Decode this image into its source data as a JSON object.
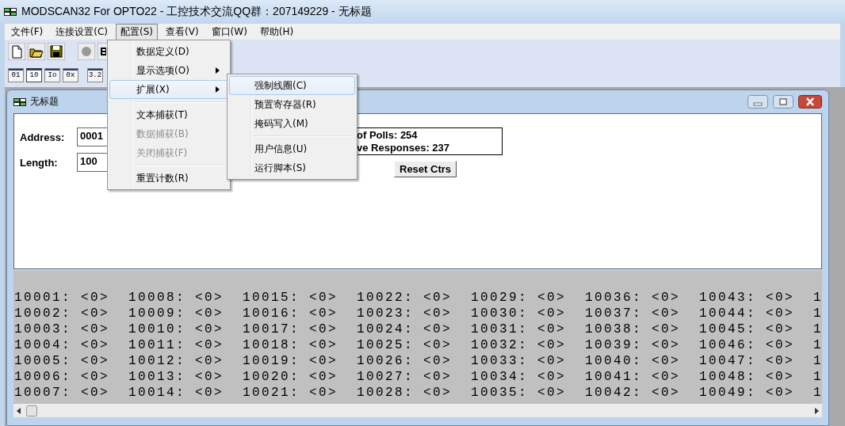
{
  "window": {
    "title": "MODSCAN32 For OPTO22 - 工控技术交流QQ群：207149229 - 无标题"
  },
  "menubar": [
    {
      "label": "文件(F)",
      "selected": false
    },
    {
      "label": "连接设置(C)",
      "selected": false
    },
    {
      "label": "配置(S)",
      "selected": true
    },
    {
      "label": "查看(V)",
      "selected": false
    },
    {
      "label": "窗口(W)",
      "selected": false
    },
    {
      "label": "帮助(H)",
      "selected": false
    }
  ],
  "toolbar_views": [
    {
      "label": "01",
      "selected": false
    },
    {
      "label": "10",
      "selected": true
    },
    {
      "label": "Io",
      "selected": false
    },
    {
      "label": "0x",
      "selected": false
    },
    {
      "label": "3.2",
      "selected": false
    }
  ],
  "menu": [
    {
      "kind": "item",
      "label": "数据定义(D)",
      "selected": false,
      "disabled": false,
      "submenu": false
    },
    {
      "kind": "item",
      "label": "显示选项(O)",
      "selected": false,
      "disabled": false,
      "submenu": true
    },
    {
      "kind": "item",
      "label": "扩展(X)",
      "selected": true,
      "disabled": false,
      "submenu": true
    },
    {
      "kind": "separator"
    },
    {
      "kind": "item",
      "label": "文本捕获(T)",
      "selected": false,
      "disabled": false,
      "submenu": false
    },
    {
      "kind": "item",
      "label": "数据捕获(B)",
      "selected": false,
      "disabled": true,
      "submenu": false
    },
    {
      "kind": "item",
      "label": "关闭捕获(F)",
      "selected": false,
      "disabled": true,
      "submenu": false
    },
    {
      "kind": "separator"
    },
    {
      "kind": "item",
      "label": "重置计数(R)",
      "selected": false,
      "disabled": false,
      "submenu": false
    }
  ],
  "submenu": [
    {
      "kind": "item",
      "label": "强制线圈(C)",
      "selected": true
    },
    {
      "kind": "item",
      "label": "预置寄存器(R)",
      "selected": false
    },
    {
      "kind": "item",
      "label": "掩码写入(M)",
      "selected": false
    },
    {
      "kind": "separator"
    },
    {
      "kind": "item",
      "label": "用户信息(U)",
      "selected": false
    },
    {
      "kind": "item",
      "label": "运行脚本(S)",
      "selected": false
    }
  ],
  "child_window": {
    "title": "无标题",
    "address": {
      "label": "Address:",
      "value": "0001"
    },
    "length": {
      "label": "Length:",
      "value": "100"
    },
    "counters": [
      "of Polls: 254",
      "ve Responses: 237"
    ],
    "reset_button": "Reset Ctrs",
    "data_rows": [
      [
        "10001: <0>",
        "10008: <0>",
        "10015: <0>",
        "10022: <0>",
        "10029: <0>",
        "10036: <0>",
        "10043: <0>",
        "1"
      ],
      [
        "10002: <0>",
        "10009: <0>",
        "10016: <0>",
        "10023: <0>",
        "10030: <0>",
        "10037: <0>",
        "10044: <0>",
        "1"
      ],
      [
        "10003: <0>",
        "10010: <0>",
        "10017: <0>",
        "10024: <0>",
        "10031: <0>",
        "10038: <0>",
        "10045: <0>",
        "1"
      ],
      [
        "10004: <0>",
        "10011: <0>",
        "10018: <0>",
        "10025: <0>",
        "10032: <0>",
        "10039: <0>",
        "10046: <0>",
        "1"
      ],
      [
        "10005: <0>",
        "10012: <0>",
        "10019: <0>",
        "10026: <0>",
        "10033: <0>",
        "10040: <0>",
        "10047: <0>",
        "1"
      ],
      [
        "10006: <0>",
        "10013: <0>",
        "10020: <0>",
        "10027: <0>",
        "10034: <0>",
        "10041: <0>",
        "10048: <0>",
        "1"
      ],
      [
        "10007: <0>",
        "10014: <0>",
        "10021: <0>",
        "10028: <0>",
        "10035: <0>",
        "10042: <0>",
        "10049: <0>",
        "1"
      ]
    ]
  }
}
